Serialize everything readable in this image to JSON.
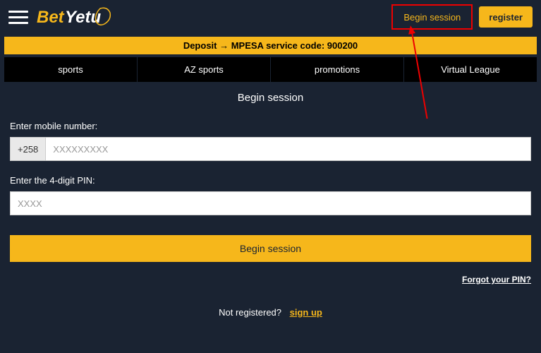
{
  "header": {
    "login_label": "Begin session",
    "register_label": "register",
    "logo_text_1": "Bet",
    "logo_text_2": "Yetu"
  },
  "deposit_bar": "Deposit → MPESA service code: 900200",
  "nav": [
    {
      "label": "sports"
    },
    {
      "label": "AZ sports"
    },
    {
      "label": "promotions"
    },
    {
      "label": "Virtual League"
    }
  ],
  "page_title": "Begin session",
  "form": {
    "mobile_label": "Enter mobile number:",
    "prefix": "+258",
    "mobile_placeholder": "XXXXXXXXX",
    "pin_label": "Enter the 4-digit PIN:",
    "pin_placeholder": "XXXX",
    "submit_label": "Begin session",
    "forgot_label": "Forgot your PIN?",
    "not_registered_label": "Not registered?",
    "signup_label": "sign up"
  }
}
